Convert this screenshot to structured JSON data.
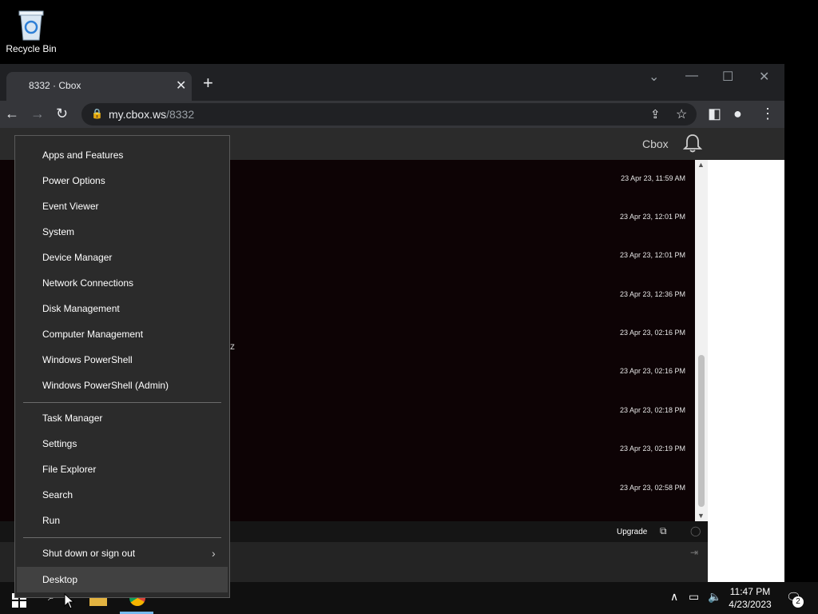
{
  "desktop": {
    "recycle_bin_label": "Recycle Bin"
  },
  "browser": {
    "tab_title": "8332 · Cbox",
    "url_host": "my.cbox.ws",
    "url_path": "/8332"
  },
  "page": {
    "brand": "Cbox",
    "timestamps": [
      "23 Apr 23, 11:59 AM",
      "23 Apr 23, 12:01 PM",
      "23 Apr 23, 12:01 PM",
      "23 Apr 23, 12:36 PM",
      "23 Apr 23, 02:16 PM",
      "23 Apr 23, 02:16 PM",
      "23 Apr 23, 02:18 PM",
      "23 Apr 23, 02:19 PM",
      "23 Apr 23, 02:58 PM"
    ],
    "stray_text": "z",
    "upgrade_label": "Upgrade"
  },
  "context_menu": {
    "items": [
      "Apps and Features",
      "Power Options",
      "Event Viewer",
      "System",
      "Device Manager",
      "Network Connections",
      "Disk Management",
      "Computer Management",
      "Windows PowerShell",
      "Windows PowerShell (Admin)",
      "Task Manager",
      "Settings",
      "File Explorer",
      "Search",
      "Run",
      "Shut down or sign out",
      "Desktop"
    ],
    "highlighted": "Desktop"
  },
  "taskbar": {
    "time": "11:47 PM",
    "date": "4/23/2023",
    "notification_count": "2"
  }
}
